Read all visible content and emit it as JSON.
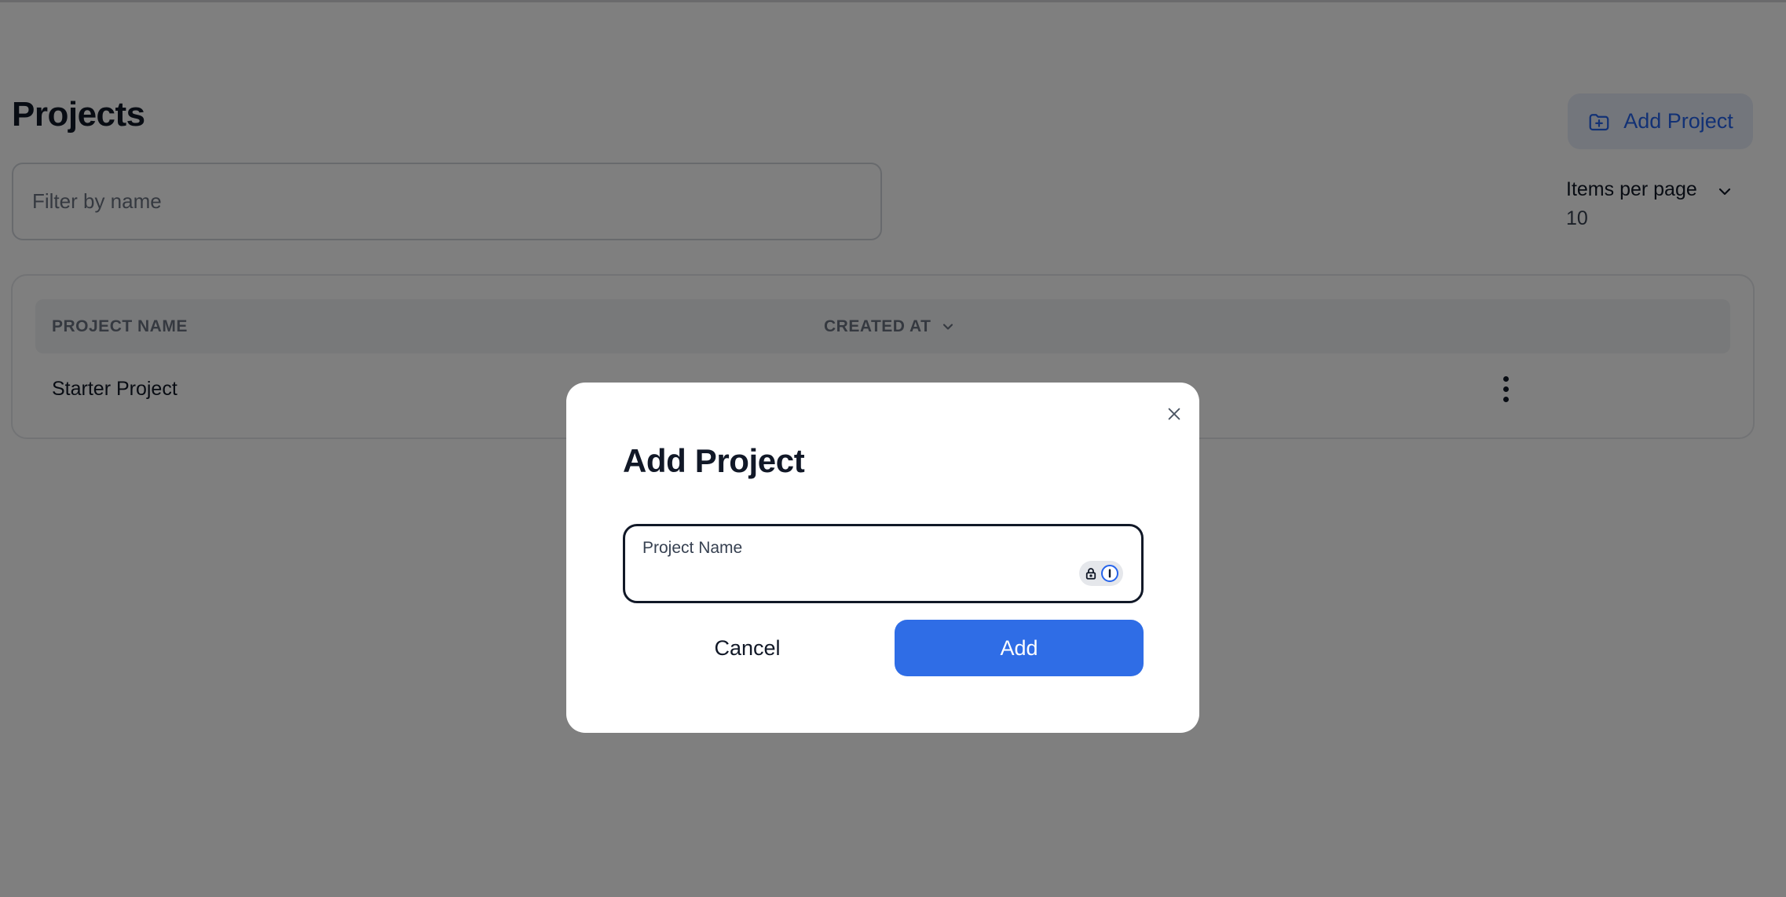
{
  "page": {
    "title": "Projects"
  },
  "header": {
    "add_project_label": "Add Project"
  },
  "filter": {
    "placeholder": "Filter by name",
    "value": ""
  },
  "pagination": {
    "items_per_page_label": "Items per page",
    "items_per_page_value": "10"
  },
  "table": {
    "columns": [
      "PROJECT NAME",
      "CREATED AT"
    ],
    "rows": [
      {
        "project_name": "Starter Project"
      }
    ]
  },
  "modal": {
    "title": "Add Project",
    "field_label": "Project Name",
    "field_value": "",
    "cancel_label": "Cancel",
    "add_label": "Add"
  },
  "icons": {
    "add_project": "folder-plus-icon",
    "items_per_page": "chevron-down-icon",
    "sort": "chevron-down-icon",
    "row_menu": "more-vertical-icon",
    "close": "close-icon",
    "password_manager": "lock-icon"
  },
  "colors": {
    "accent": "#2f6de6",
    "add_project_bg": "#e6ecf8",
    "overlay": "rgba(0,0,0,0.5)"
  }
}
